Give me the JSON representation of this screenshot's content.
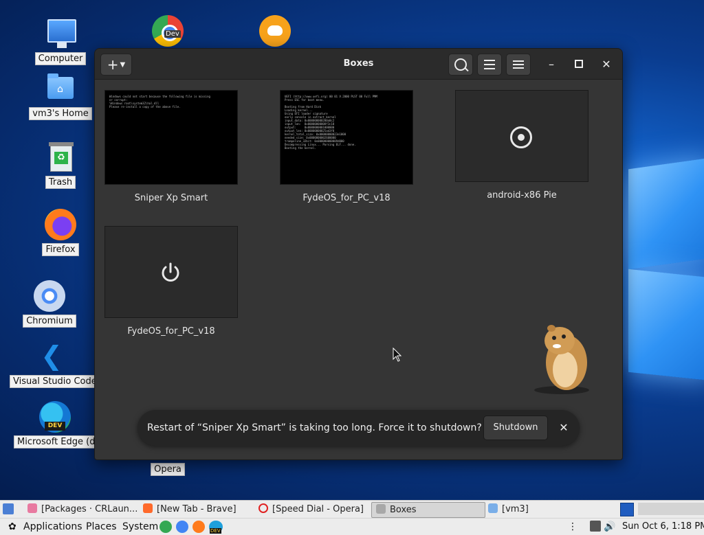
{
  "desktop": {
    "icons": [
      {
        "label": "Computer"
      },
      {
        "label": "vm3's Home"
      },
      {
        "label": "Trash"
      },
      {
        "label": "Firefox"
      },
      {
        "label": "Chromium"
      },
      {
        "label": "Visual Studio Code"
      },
      {
        "label": "Microsoft Edge (de"
      },
      {
        "label": "Opera"
      }
    ],
    "top_icons": [
      {
        "icon": "chrome-dev-icon",
        "badge": "Dev"
      },
      {
        "icon": "discord-icon"
      }
    ],
    "edge_badge": "DEV"
  },
  "window": {
    "title": "Boxes",
    "boxes": [
      {
        "name": "Sniper Xp Smart",
        "state": "running-screen"
      },
      {
        "name": "FydeOS_for_PC_v18",
        "state": "running-screen"
      },
      {
        "name": "android-x86 Pie",
        "state": "loading"
      },
      {
        "name": "FydeOS_for_PC_v18",
        "state": "powered-off"
      }
    ],
    "notification": {
      "message": "Restart of “Sniper Xp Smart” is taking too long. Force it to shutdown?",
      "action_label": "Shutdown"
    }
  },
  "taskbar": {
    "tasks": [
      {
        "label": "[Packages · CRLaun..."
      },
      {
        "label": "[New Tab - Brave]"
      },
      {
        "label": "[Speed Dial - Opera]"
      },
      {
        "label": "Boxes"
      },
      {
        "label": "[vm3]"
      }
    ],
    "menus": [
      "Applications",
      "Places",
      "System"
    ],
    "launcher_badge": "DEV",
    "clock": "Sun Oct  6,  1:18 PM"
  },
  "colors": {
    "window_bg": "#353535",
    "headerbar_bg": "#2b2b2b",
    "panel_bg": "#ececec"
  }
}
